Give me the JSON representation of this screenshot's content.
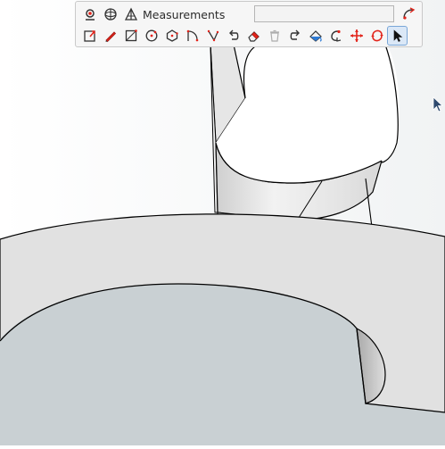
{
  "toolbar": {
    "measurements_label": "Measurements",
    "measurements_value": "",
    "tools_row1": [
      "select-parent-icon",
      "orbit-icon",
      "measurements-icon"
    ],
    "tools_row2": [
      "rectangle-push-icon",
      "pencil-icon",
      "rectangle-icon",
      "circle-icon",
      "polygon-icon",
      "arc-icon",
      "freehand-arc-icon",
      "undo-icon",
      "eraser-icon",
      "trash-icon",
      "redo-icon",
      "paint-bucket-icon",
      "follow-me-icon",
      "move-icon",
      "rotate-icon",
      "select-arrow-icon"
    ],
    "active_tool": "select-arrow-icon"
  },
  "scene": {
    "model_fill": "#ffffff",
    "face_gray": "#e0e0e0",
    "inner_face": "#c9d0d3",
    "edge_color": "#000000",
    "background": "#ffffff"
  },
  "cursor": {
    "icon": "cursor-arrow-icon",
    "color": "#2f4a6e"
  }
}
